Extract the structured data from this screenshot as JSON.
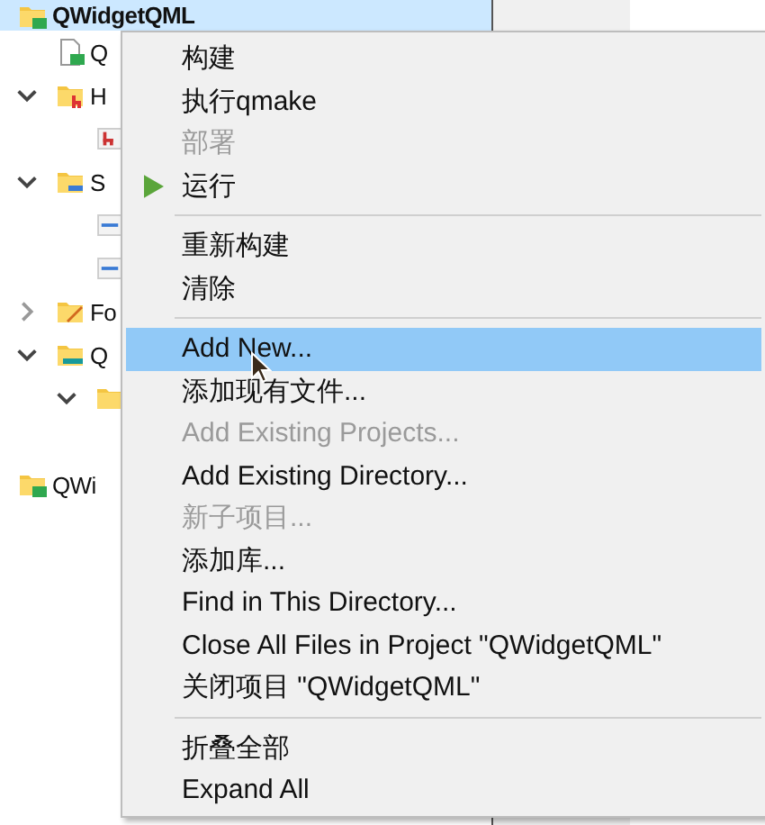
{
  "tree": [
    {
      "label": "QWidgetQML",
      "kind": "project",
      "selected": true,
      "children": [
        {
          "label": "Q",
          "kind": "qt-file",
          "selected": false
        },
        {
          "label": "H",
          "kind": "header-folder",
          "selected": false,
          "expanded": true,
          "children": [
            {
              "kind": "header-file",
              "selected": false
            }
          ]
        },
        {
          "label": "S",
          "kind": "source-folder",
          "selected": false,
          "expanded": true,
          "children": [
            {
              "kind": "cpp-file",
              "selected": false
            },
            {
              "kind": "cpp-file",
              "selected": false
            }
          ]
        },
        {
          "label": "Fo",
          "kind": "forms-folder",
          "selected": false,
          "expanded": false
        },
        {
          "label": "Q",
          "kind": "qml-folder",
          "selected": false,
          "expanded": true,
          "children": [
            {
              "kind": "folder",
              "selected": false,
              "expanded": true
            }
          ]
        }
      ]
    },
    {
      "label": "QWi",
      "kind": "project",
      "selected": false,
      "gap_before": true
    }
  ],
  "context_menu": {
    "items": [
      {
        "kind": "item",
        "label": "构建",
        "disabled": false,
        "selected": false
      },
      {
        "kind": "item",
        "label": "执行qmake",
        "disabled": false,
        "selected": false
      },
      {
        "kind": "item",
        "label": "部署",
        "disabled": true,
        "selected": false
      },
      {
        "kind": "play-item",
        "label": "运行",
        "disabled": false,
        "selected": false
      },
      {
        "kind": "separator"
      },
      {
        "kind": "item",
        "label": "重新构建",
        "disabled": false,
        "selected": false
      },
      {
        "kind": "item",
        "label": "清除",
        "disabled": false,
        "selected": false
      },
      {
        "kind": "separator"
      },
      {
        "kind": "item",
        "label": "Add New...",
        "disabled": false,
        "selected": true
      },
      {
        "kind": "item",
        "label": "添加现有文件...",
        "disabled": false,
        "selected": false
      },
      {
        "kind": "item",
        "label": "Add Existing Projects...",
        "disabled": true,
        "selected": false
      },
      {
        "kind": "item",
        "label": "Add Existing Directory...",
        "disabled": false,
        "selected": false
      },
      {
        "kind": "item",
        "label": "新子项目...",
        "disabled": true,
        "selected": false
      },
      {
        "kind": "item",
        "label": "添加库...",
        "disabled": false,
        "selected": false
      },
      {
        "kind": "item",
        "label": "Find in This Directory...",
        "disabled": false,
        "selected": false
      },
      {
        "kind": "item",
        "label": "Close All Files in Project \"QWidgetQML\"",
        "disabled": false,
        "selected": false
      },
      {
        "kind": "item",
        "label": "关闭项目 \"QWidgetQML\"",
        "disabled": false,
        "selected": false
      },
      {
        "kind": "separator"
      },
      {
        "kind": "item",
        "label": "折叠全部",
        "disabled": false,
        "selected": false
      },
      {
        "kind": "item",
        "label": "Expand All",
        "disabled": false,
        "selected": false
      }
    ]
  }
}
